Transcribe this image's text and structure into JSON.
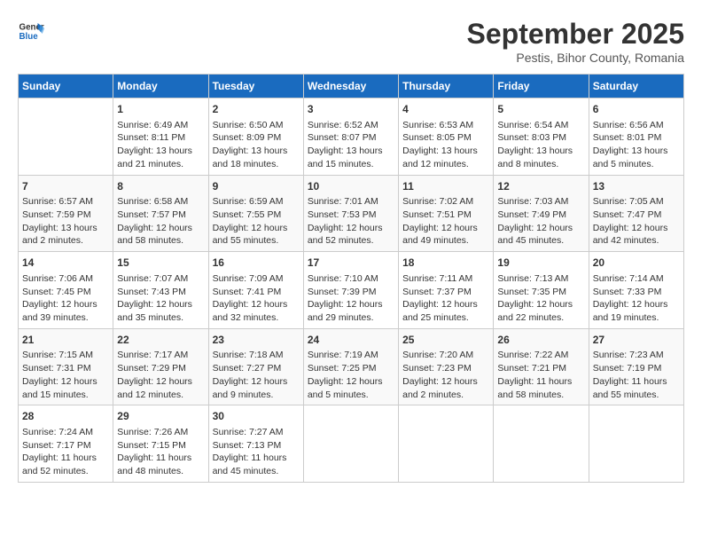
{
  "header": {
    "logo_line1": "General",
    "logo_line2": "Blue",
    "month": "September 2025",
    "location": "Pestis, Bihor County, Romania"
  },
  "weekdays": [
    "Sunday",
    "Monday",
    "Tuesday",
    "Wednesday",
    "Thursday",
    "Friday",
    "Saturday"
  ],
  "weeks": [
    [
      {
        "day": "",
        "info": ""
      },
      {
        "day": "1",
        "info": "Sunrise: 6:49 AM\nSunset: 8:11 PM\nDaylight: 13 hours and 21 minutes."
      },
      {
        "day": "2",
        "info": "Sunrise: 6:50 AM\nSunset: 8:09 PM\nDaylight: 13 hours and 18 minutes."
      },
      {
        "day": "3",
        "info": "Sunrise: 6:52 AM\nSunset: 8:07 PM\nDaylight: 13 hours and 15 minutes."
      },
      {
        "day": "4",
        "info": "Sunrise: 6:53 AM\nSunset: 8:05 PM\nDaylight: 13 hours and 12 minutes."
      },
      {
        "day": "5",
        "info": "Sunrise: 6:54 AM\nSunset: 8:03 PM\nDaylight: 13 hours and 8 minutes."
      },
      {
        "day": "6",
        "info": "Sunrise: 6:56 AM\nSunset: 8:01 PM\nDaylight: 13 hours and 5 minutes."
      }
    ],
    [
      {
        "day": "7",
        "info": "Sunrise: 6:57 AM\nSunset: 7:59 PM\nDaylight: 13 hours and 2 minutes."
      },
      {
        "day": "8",
        "info": "Sunrise: 6:58 AM\nSunset: 7:57 PM\nDaylight: 12 hours and 58 minutes."
      },
      {
        "day": "9",
        "info": "Sunrise: 6:59 AM\nSunset: 7:55 PM\nDaylight: 12 hours and 55 minutes."
      },
      {
        "day": "10",
        "info": "Sunrise: 7:01 AM\nSunset: 7:53 PM\nDaylight: 12 hours and 52 minutes."
      },
      {
        "day": "11",
        "info": "Sunrise: 7:02 AM\nSunset: 7:51 PM\nDaylight: 12 hours and 49 minutes."
      },
      {
        "day": "12",
        "info": "Sunrise: 7:03 AM\nSunset: 7:49 PM\nDaylight: 12 hours and 45 minutes."
      },
      {
        "day": "13",
        "info": "Sunrise: 7:05 AM\nSunset: 7:47 PM\nDaylight: 12 hours and 42 minutes."
      }
    ],
    [
      {
        "day": "14",
        "info": "Sunrise: 7:06 AM\nSunset: 7:45 PM\nDaylight: 12 hours and 39 minutes."
      },
      {
        "day": "15",
        "info": "Sunrise: 7:07 AM\nSunset: 7:43 PM\nDaylight: 12 hours and 35 minutes."
      },
      {
        "day": "16",
        "info": "Sunrise: 7:09 AM\nSunset: 7:41 PM\nDaylight: 12 hours and 32 minutes."
      },
      {
        "day": "17",
        "info": "Sunrise: 7:10 AM\nSunset: 7:39 PM\nDaylight: 12 hours and 29 minutes."
      },
      {
        "day": "18",
        "info": "Sunrise: 7:11 AM\nSunset: 7:37 PM\nDaylight: 12 hours and 25 minutes."
      },
      {
        "day": "19",
        "info": "Sunrise: 7:13 AM\nSunset: 7:35 PM\nDaylight: 12 hours and 22 minutes."
      },
      {
        "day": "20",
        "info": "Sunrise: 7:14 AM\nSunset: 7:33 PM\nDaylight: 12 hours and 19 minutes."
      }
    ],
    [
      {
        "day": "21",
        "info": "Sunrise: 7:15 AM\nSunset: 7:31 PM\nDaylight: 12 hours and 15 minutes."
      },
      {
        "day": "22",
        "info": "Sunrise: 7:17 AM\nSunset: 7:29 PM\nDaylight: 12 hours and 12 minutes."
      },
      {
        "day": "23",
        "info": "Sunrise: 7:18 AM\nSunset: 7:27 PM\nDaylight: 12 hours and 9 minutes."
      },
      {
        "day": "24",
        "info": "Sunrise: 7:19 AM\nSunset: 7:25 PM\nDaylight: 12 hours and 5 minutes."
      },
      {
        "day": "25",
        "info": "Sunrise: 7:20 AM\nSunset: 7:23 PM\nDaylight: 12 hours and 2 minutes."
      },
      {
        "day": "26",
        "info": "Sunrise: 7:22 AM\nSunset: 7:21 PM\nDaylight: 11 hours and 58 minutes."
      },
      {
        "day": "27",
        "info": "Sunrise: 7:23 AM\nSunset: 7:19 PM\nDaylight: 11 hours and 55 minutes."
      }
    ],
    [
      {
        "day": "28",
        "info": "Sunrise: 7:24 AM\nSunset: 7:17 PM\nDaylight: 11 hours and 52 minutes."
      },
      {
        "day": "29",
        "info": "Sunrise: 7:26 AM\nSunset: 7:15 PM\nDaylight: 11 hours and 48 minutes."
      },
      {
        "day": "30",
        "info": "Sunrise: 7:27 AM\nSunset: 7:13 PM\nDaylight: 11 hours and 45 minutes."
      },
      {
        "day": "",
        "info": ""
      },
      {
        "day": "",
        "info": ""
      },
      {
        "day": "",
        "info": ""
      },
      {
        "day": "",
        "info": ""
      }
    ]
  ]
}
